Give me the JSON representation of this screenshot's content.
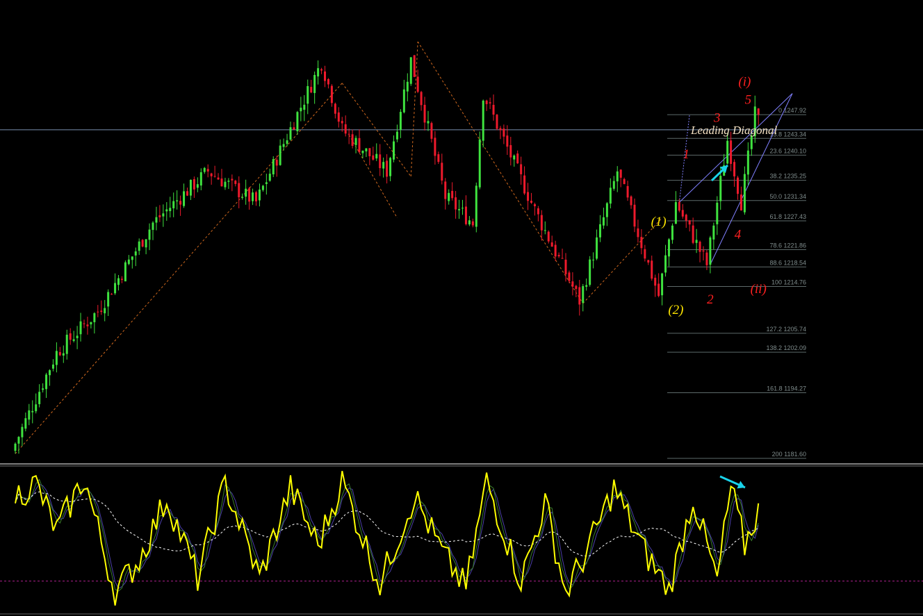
{
  "title": "Leading Diagonal",
  "colors": {
    "background": "#000000",
    "bull_candle": "#3fe23f",
    "bear_candle": "#ee1a2c",
    "zigzag": "#d2691e",
    "channel": "#8080ff",
    "fib_line": "#5e6a6a",
    "fib_text": "#7f8c8c",
    "price_line": "#7a8fb0",
    "separator": "#ffffff",
    "osc_main": "#ffff00",
    "osc_signal_1": "#3a7d2a",
    "osc_signal_2": "#4b3fa8",
    "osc_mid": "#ffffff",
    "osc_level": "#b0208f",
    "arrow": "#19d3ea",
    "label_yellow": "#ffe600",
    "label_red": "#ff2020",
    "title_text": "#f3e0c2"
  },
  "chart_data": [
    {
      "type": "candlestick",
      "title": "Leading Diagonal",
      "ylim": [
        1181.6,
        1262
      ],
      "horizontal_line": 1245,
      "fibonacci_levels": [
        {
          "label": "0 1247.92",
          "level": 0,
          "price": 1247.92
        },
        {
          "label": "13.8 1243.34",
          "level": 13.8,
          "price": 1243.34
        },
        {
          "label": "23.6 1240.10",
          "level": 23.6,
          "price": 1240.1
        },
        {
          "label": "38.2 1235.25",
          "level": 38.2,
          "price": 1235.25
        },
        {
          "label": "50.0 1231.34",
          "level": 50.0,
          "price": 1231.34
        },
        {
          "label": "61.8 1227.43",
          "level": 61.8,
          "price": 1227.43
        },
        {
          "label": "78.6 1221.86",
          "level": 78.6,
          "price": 1221.86
        },
        {
          "label": "88.6 1218.54",
          "level": 88.6,
          "price": 1218.54
        },
        {
          "label": "100 1214.76",
          "level": 100,
          "price": 1214.76
        },
        {
          "label": "127.2 1205.74",
          "level": 127.2,
          "price": 1205.74
        },
        {
          "label": "138.2 1202.09",
          "level": 138.2,
          "price": 1202.09
        },
        {
          "label": "161.8 1194.27",
          "level": 161.8,
          "price": 1194.27
        },
        {
          "label": "200 1181.60",
          "level": 200,
          "price": 1181.6
        }
      ],
      "anchors": [
        {
          "bar": 0,
          "price": 1183.0
        },
        {
          "bar": 13,
          "price": 1202.0
        },
        {
          "bar": 25,
          "price": 1210.0
        },
        {
          "bar": 41,
          "price": 1227.0
        },
        {
          "bar": 57,
          "price": 1237.0
        },
        {
          "bar": 71,
          "price": 1231.0
        },
        {
          "bar": 90,
          "price": 1258.0
        },
        {
          "bar": 96,
          "price": 1245.0
        },
        {
          "bar": 109,
          "price": 1237.0
        },
        {
          "bar": 116,
          "price": 1258.5
        },
        {
          "bar": 126,
          "price": 1232.0
        },
        {
          "bar": 134,
          "price": 1227.0
        },
        {
          "bar": 137,
          "price": 1252.0
        },
        {
          "bar": 152,
          "price": 1229.5
        },
        {
          "bar": 165,
          "price": 1212.0
        },
        {
          "bar": 176,
          "price": 1237.0
        },
        {
          "bar": 188,
          "price": 1213.0
        },
        {
          "bar": 193,
          "price": 1231.0
        },
        {
          "bar": 202,
          "price": 1219.0
        },
        {
          "bar": 208,
          "price": 1243.0
        },
        {
          "bar": 212,
          "price": 1231.0
        },
        {
          "bar": 216,
          "price": 1247.92
        }
      ],
      "bar_count": 217,
      "zigzag": [
        {
          "bar": 0,
          "price": 1182.5
        },
        {
          "bar": 95,
          "price": 1254.0
        },
        {
          "bar": 115,
          "price": 1236.0
        },
        {
          "bar": 117,
          "price": 1262.0
        },
        {
          "bar": 165,
          "price": 1211.5
        },
        {
          "bar": 188,
          "price": 1228.0
        }
      ],
      "wave_labels": [
        {
          "text": "(i)",
          "bar": 212,
          "price": 1253.5,
          "color": "label_red"
        },
        {
          "text": "5",
          "bar": 213,
          "price": 1250.0,
          "color": "label_red"
        },
        {
          "text": "3",
          "bar": 204,
          "price": 1246.5,
          "color": "label_red"
        },
        {
          "text": "1",
          "bar": 195,
          "price": 1239.5,
          "color": "label_red"
        },
        {
          "text": "4",
          "bar": 210,
          "price": 1224.0,
          "color": "label_red"
        },
        {
          "text": "2",
          "bar": 202,
          "price": 1211.5,
          "color": "label_red"
        },
        {
          "text": "(ii)",
          "bar": 216,
          "price": 1213.5,
          "color": "label_red"
        },
        {
          "text": "(1)",
          "bar": 187,
          "price": 1226.5,
          "color": "label_yellow"
        },
        {
          "text": "(2)",
          "bar": 192,
          "price": 1209.5,
          "color": "label_yellow"
        }
      ]
    },
    {
      "type": "line",
      "ylim": [
        0,
        100
      ],
      "level": 20,
      "series_anchors": [
        {
          "bar": 0,
          "value": 80
        },
        {
          "bar": 6,
          "value": 88
        },
        {
          "bar": 12,
          "value": 55
        },
        {
          "bar": 20,
          "value": 92
        },
        {
          "bar": 29,
          "value": 12
        },
        {
          "bar": 36,
          "value": 35
        },
        {
          "bar": 44,
          "value": 78
        },
        {
          "bar": 53,
          "value": 22
        },
        {
          "bar": 61,
          "value": 88
        },
        {
          "bar": 71,
          "value": 22
        },
        {
          "bar": 80,
          "value": 85
        },
        {
          "bar": 88,
          "value": 45
        },
        {
          "bar": 95,
          "value": 90
        },
        {
          "bar": 106,
          "value": 18
        },
        {
          "bar": 116,
          "value": 80
        },
        {
          "bar": 124,
          "value": 40
        },
        {
          "bar": 131,
          "value": 15
        },
        {
          "bar": 137,
          "value": 90
        },
        {
          "bar": 147,
          "value": 20
        },
        {
          "bar": 154,
          "value": 75
        },
        {
          "bar": 160,
          "value": 12
        },
        {
          "bar": 166,
          "value": 40
        },
        {
          "bar": 174,
          "value": 85
        },
        {
          "bar": 183,
          "value": 40
        },
        {
          "bar": 190,
          "value": 14
        },
        {
          "bar": 197,
          "value": 78
        },
        {
          "bar": 204,
          "value": 20
        },
        {
          "bar": 208,
          "value": 85
        },
        {
          "bar": 212,
          "value": 45
        },
        {
          "bar": 216,
          "value": 70
        }
      ]
    }
  ]
}
